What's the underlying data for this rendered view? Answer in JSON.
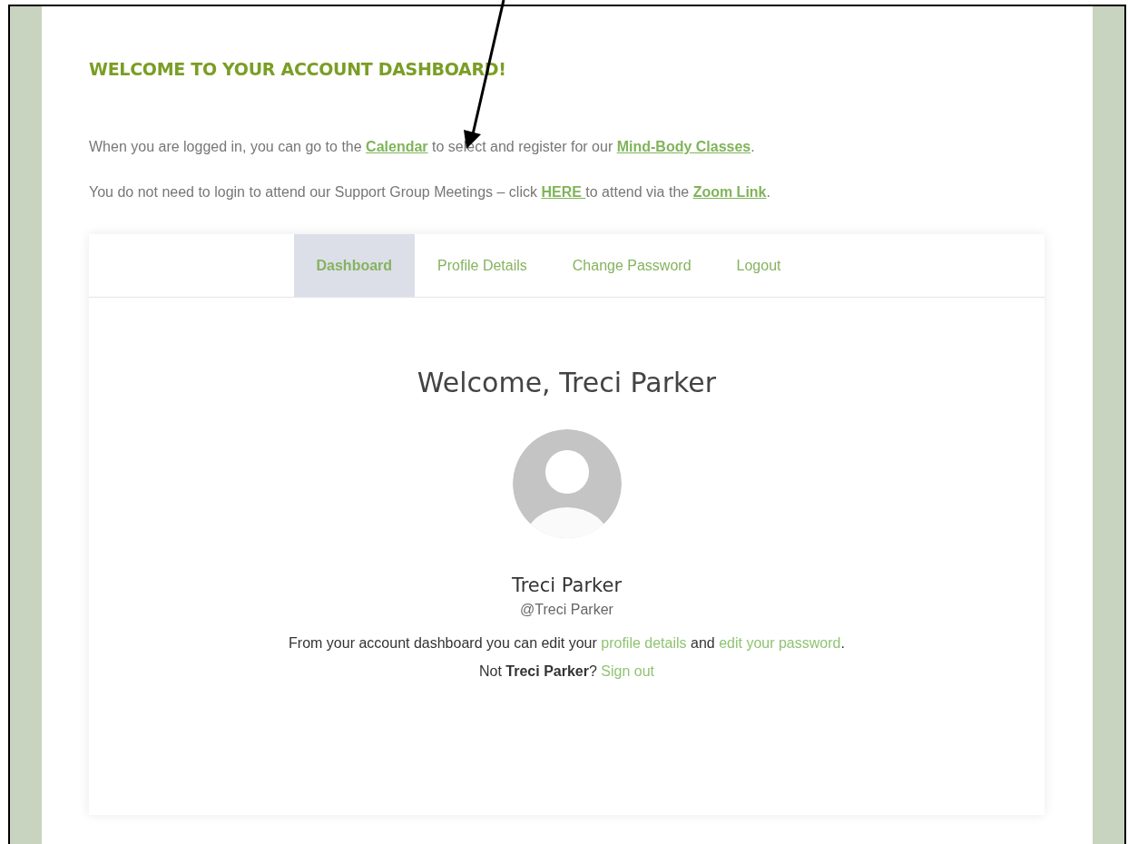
{
  "heading": "WELCOME TO YOUR ACCOUNT DASHBOARD!",
  "intro": [
    [
      {
        "kind": "text",
        "text": "When you are logged in, you can go to the "
      },
      {
        "kind": "link",
        "text": "Calendar"
      },
      {
        "kind": "text",
        "text": " to select and register for our "
      },
      {
        "kind": "link",
        "text": "Mind-Body Classes"
      },
      {
        "kind": "text",
        "text": "."
      }
    ],
    [
      {
        "kind": "text",
        "text": "You do not need to login to attend our Support Group Meetings – click "
      },
      {
        "kind": "link",
        "text": "HERE "
      },
      {
        "kind": "text",
        "text": "to attend via the "
      },
      {
        "kind": "link",
        "text": "Zoom Link"
      },
      {
        "kind": "text",
        "text": "."
      }
    ]
  ],
  "tabs": [
    {
      "label": "Dashboard",
      "selected": true
    },
    {
      "label": "Profile Details",
      "selected": false
    },
    {
      "label": "Change Password",
      "selected": false
    },
    {
      "label": "Logout",
      "selected": false
    }
  ],
  "profile": {
    "greeting": "Welcome, Treci Parker",
    "name": "Treci Parker",
    "handle": "@Treci Parker"
  },
  "notes": [
    [
      {
        "kind": "text",
        "text": "From your account dashboard you can edit your "
      },
      {
        "kind": "link",
        "text": "profile details"
      },
      {
        "kind": "text",
        "text": " and "
      },
      {
        "kind": "link",
        "text": "edit your password"
      },
      {
        "kind": "text",
        "text": "."
      }
    ],
    [
      {
        "kind": "text",
        "text": "Not **Treci Parker**? "
      },
      {
        "kind": "link",
        "text": "Sign out"
      }
    ]
  ]
}
